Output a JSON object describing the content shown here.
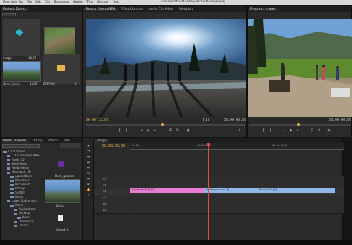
{
  "menubar": {
    "items": [
      "Premiere Pro",
      "File",
      "Edit",
      "Clip",
      "Sequence",
      "Marker",
      "Title",
      "Window",
      "Help"
    ],
    "title": "/Users/PRMS/Desktop/Demo/Demo.prproj"
  },
  "project": {
    "tab": "Project: Demo",
    "search_placeholder": "",
    "items": [
      {
        "name": "Image",
        "meta": "10:27",
        "icon": "sequence-icon"
      },
      {
        "name": "xxxGarden.PS",
        "meta": "5:25"
      },
      {
        "name": "Demo_Video",
        "meta": "10:07"
      },
      {
        "name": "DREAMS",
        "meta": "2"
      }
    ]
  },
  "source": {
    "tabs": [
      "Source: Demo.MP4",
      "Effect Controls",
      "Audio Clip Mixer",
      "Metadata"
    ],
    "tc_in": "00:00:13:07",
    "tc_out": "00:00:05:00",
    "fit": "Fit"
  },
  "program": {
    "tab": "Program: Image",
    "tc_out": "00:00:00:00"
  },
  "media": {
    "tabs": [
      "Media Browser",
      "Library",
      "Effects",
      "Info"
    ],
    "tree": [
      "Local Drives",
      "CD TO Storage (NAS)",
      "Audio CD",
      "SoftMSeeds",
      "Adobe Video",
      "Macintosh HD",
      "Applications",
      "Developer",
      "Documents",
      "Library",
      "System",
      "Users",
      "Laser Studios Arch",
      "Users",
      "Applications",
      "Desktop",
      "Demo",
      "Downloads",
      "Library"
    ],
    "preview_label": "Demo_project",
    "preview2_label": "Demo",
    "file_label": "Demo3.R"
  },
  "timeline": {
    "tab": "Image",
    "tc": "00:00:00:00",
    "ruler": [
      "00:00",
      "00:00:05:00",
      "00:00:10:00"
    ],
    "tracks": [
      "V3",
      "V2",
      "V1",
      "A1",
      "A2",
      "A3"
    ],
    "clips": [
      {
        "name": "xxxGarden.PSD [V]",
        "color": "#e77dd3"
      },
      {
        "name": "Landscape.mp4 [V]",
        "color": "#8fb8e8"
      },
      {
        "name": "Demo.MP4 [V]",
        "color": "#8fb8e8"
      }
    ]
  }
}
